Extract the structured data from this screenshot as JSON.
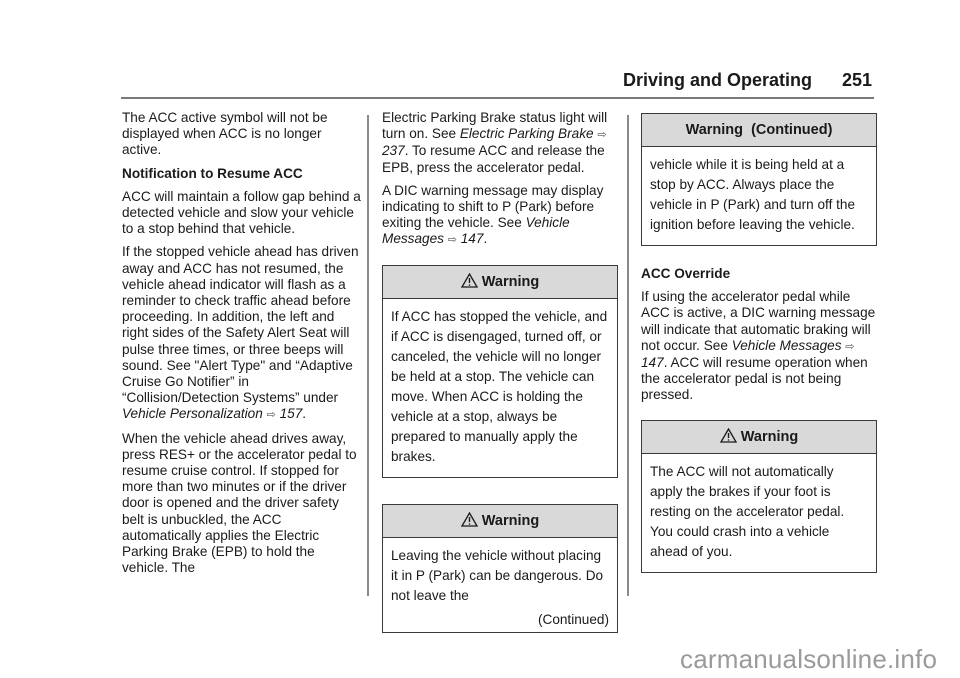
{
  "header": {
    "section_title": "Driving and Operating",
    "page_number": "251"
  },
  "column1": {
    "p1": "The ACC active symbol will not be displayed when ACC is no longer active.",
    "heading": "Notification to Resume ACC",
    "p2": "ACC will maintain a follow gap behind a detected vehicle and slow your vehicle to a stop behind that vehicle.",
    "p3": "If the stopped vehicle ahead has driven away and ACC has not resumed, the vehicle ahead indicator will flash as a reminder to check traffic ahead before proceeding. In addition, the left and right sides of the Safety Alert Seat will pulse three times, or three beeps will sound. See \"Alert Type\" and “Adaptive Cruise Go Notifier” in “Collision/Detection Systems” under ",
    "p3_link": "Vehicle Personalization",
    "p3_ref_icon": "page-ref-arrow-icon",
    "p3_ref": "157",
    "p4": "When the vehicle ahead drives away, press RES+ or the accelerator pedal to resume cruise control. If stopped for more than two minutes or if the driver door is opened and the driver safety belt is unbuckled, the ACC automatically applies the Electric Parking Brake (EPB) to hold the vehicle. The"
  },
  "column2": {
    "p1_a": "Electric Parking Brake status light will turn on. See ",
    "p1_link": "Electric Parking Brake",
    "p1_ref": "237",
    "p1_b": ". To resume ACC and release the EPB, press the accelerator pedal.",
    "p2_a": "A DIC warning message may display indicating to shift to P (Park) before exiting the vehicle. See ",
    "p2_link": "Vehicle Messages",
    "p2_ref": "147",
    "warning1": {
      "icon": "warning-triangle-icon",
      "title": "Warning",
      "body": "If ACC has stopped the vehicle, and if ACC is disengaged, turned off, or canceled, the vehicle will no longer be held at a stop. The vehicle can move. When ACC is holding the vehicle at a stop, always be prepared to manually apply the brakes."
    },
    "warning2": {
      "icon": "warning-triangle-icon",
      "title": "Warning",
      "body": "Leaving the vehicle without placing it in P (Park) can be dangerous. Do not leave the",
      "continued": "(Continued)"
    }
  },
  "column3": {
    "warning_cont": {
      "title": "Warning  (Continued)",
      "body": "vehicle while it is being held at a stop by ACC. Always place the vehicle in P (Park) and turn off the ignition before leaving the vehicle."
    },
    "heading": "ACC Override",
    "p1_a": "If using the accelerator pedal while ACC is active, a DIC warning message will indicate that automatic braking will not occur. See ",
    "p1_link": "Vehicle Messages",
    "p1_ref": "147",
    "p1_b": ". ACC will resume operation when the accelerator pedal is not being pressed.",
    "warning3": {
      "icon": "warning-triangle-icon",
      "title": "Warning",
      "body": "The ACC will not automatically apply the brakes if your foot is resting on the accelerator pedal. You could crash into a vehicle ahead of you."
    }
  },
  "watermark": "carmanualsonline.info",
  "colors": {
    "warning_header_bg": "#d9d9d9",
    "rule": "#7a7a7a",
    "watermark": "#9a9a9a"
  }
}
